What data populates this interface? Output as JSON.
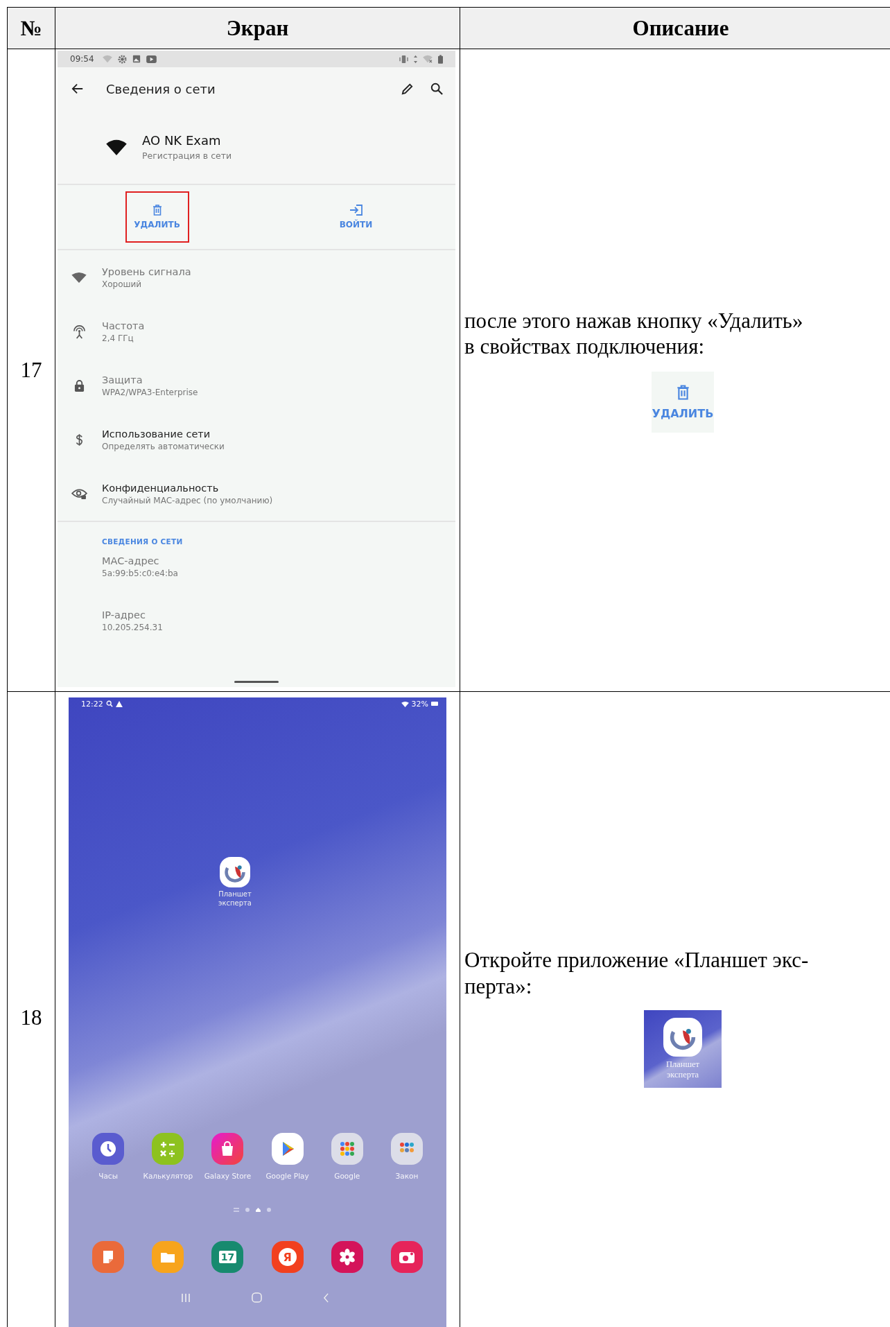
{
  "table": {
    "columns": [
      "№",
      "Экран",
      "Описание"
    ],
    "rows": [
      {
        "number": "17",
        "screen": {
          "kind": "settings",
          "status_time": "09:54",
          "title": "Сведения о сети",
          "network": {
            "name": "AO NK Exam",
            "status": "Регистрация в сети"
          },
          "actions": [
            {
              "kind": "delete",
              "label": "УДАЛИТЬ",
              "highlighted": true
            },
            {
              "kind": "login",
              "label": "ВОЙТИ",
              "highlighted": false
            }
          ],
          "items": [
            {
              "kind": "signal",
              "title": "Уровень сигнала",
              "value": "Хороший",
              "emphasized": false
            },
            {
              "kind": "frequency",
              "title": "Частота",
              "value": "2,4 ГГц",
              "emphasized": false
            },
            {
              "kind": "lock",
              "title": "Защита",
              "value": "WPA2/WPA3-Enterprise",
              "emphasized": false
            },
            {
              "kind": "usage",
              "title": "Использование сети",
              "value": "Определять автоматически",
              "emphasized": true
            },
            {
              "kind": "privacy",
              "title": "Конфиденциальность",
              "value": "Случайный MAC-адрес (по умолчанию)",
              "emphasized": true
            }
          ],
          "section": "СВЕДЕНИЯ О СЕТИ",
          "details": [
            {
              "title": "MAC-адрес",
              "value": "5a:99:b5:c0:e4:ba"
            },
            {
              "title": "IP-адрес",
              "value": "10.205.254.31"
            }
          ]
        },
        "description": {
          "text": "после этого нажав кнопку «Удалить»\nв свойствах подключения:",
          "preview": {
            "kind": "button",
            "label": "УДАЛИТЬ"
          }
        }
      },
      {
        "number": "18",
        "screen": {
          "kind": "home",
          "status_time": "12:22",
          "battery": "32%",
          "desktop_app": {
            "label": "Планшет\nэксперта"
          },
          "apps": [
            {
              "kind": "clock",
              "label": "Часы"
            },
            {
              "kind": "calculator",
              "label": "Калькулятор"
            },
            {
              "kind": "store",
              "label": "Galaxy Store"
            },
            {
              "kind": "play",
              "label": "Google Play"
            },
            {
              "kind": "google-folder",
              "label": "Google"
            },
            {
              "kind": "law-folder",
              "label": "Закон"
            }
          ],
          "pages": [
            {
              "kind": "lines",
              "selected": false
            },
            {
              "kind": "dot",
              "selected": false
            },
            {
              "kind": "home",
              "selected": true
            },
            {
              "kind": "dot",
              "selected": false
            }
          ],
          "dock": [
            {
              "kind": "notes"
            },
            {
              "kind": "files"
            },
            {
              "kind": "calendar",
              "label": "17"
            },
            {
              "kind": "yandex",
              "label": "Я"
            },
            {
              "kind": "flower"
            },
            {
              "kind": "camera"
            }
          ]
        },
        "description": {
          "text": "Откройте приложение «Планшет экс-\nперта»:",
          "preview": {
            "kind": "app",
            "label": "Планшет\nэксперта"
          }
        }
      }
    ]
  }
}
